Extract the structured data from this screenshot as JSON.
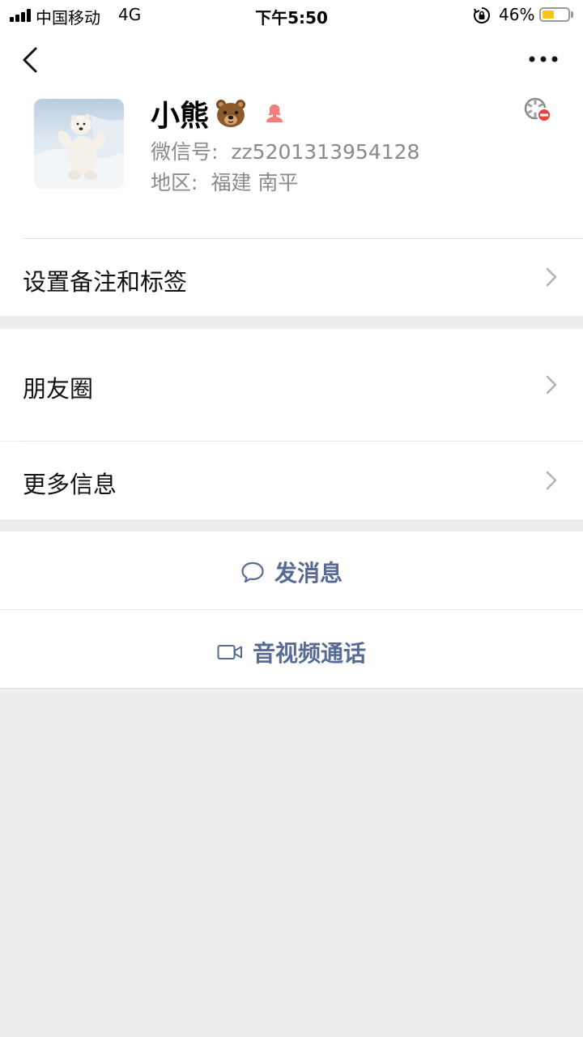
{
  "status_bar": {
    "carrier": "中国移动",
    "network": "4G",
    "time": "下午5:50",
    "battery_percent": "46%",
    "battery_level": 0.46,
    "icons": [
      "signal-icon",
      "rotation-lock-icon",
      "battery-icon"
    ]
  },
  "nav": {
    "back_icon": "chevron-left-icon",
    "more_icon": "more-dots-icon"
  },
  "profile": {
    "name": "小熊",
    "name_emoji_icon": "bear-face-icon",
    "gender_icon": "female-icon",
    "wechat_id_label": "微信号:",
    "wechat_id_value": "zz5201313954128",
    "region_label": "地区:",
    "region_value": "福建 南平",
    "blocked_moments_icon": "moments-blocked-icon",
    "avatar": "polar-bear-photo"
  },
  "menu": {
    "remark_tags": "设置备注和标签",
    "moments": "朋友圈",
    "more_info": "更多信息"
  },
  "actions": {
    "send_message": "发消息",
    "av_call": "音视频通话",
    "message_icon": "chat-bubble-icon",
    "video_icon": "video-camera-icon"
  },
  "colors": {
    "link_blue": "#576b95",
    "background": "#ededed",
    "gender_female": "#f37e7d",
    "battery": "#f5c518"
  }
}
